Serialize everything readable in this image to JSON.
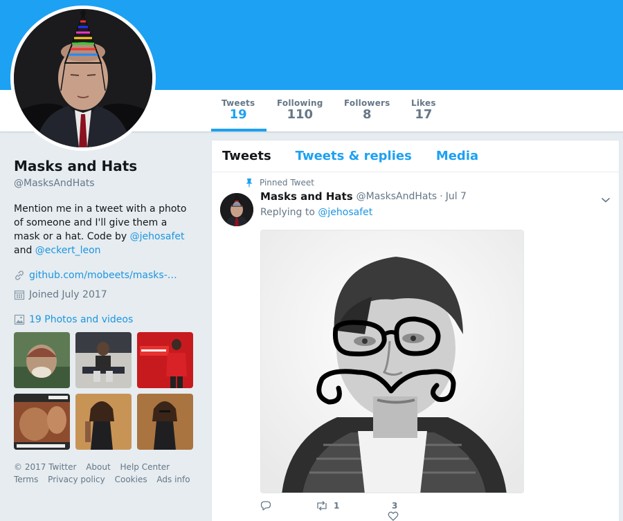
{
  "profile": {
    "name": "Masks and Hats",
    "handle": "@MasksAndHats",
    "bio_text": "Mention me in a tweet with a photo of someone and I'll give them a mask or a hat. Code by ",
    "bio_link1": "@jehosafet",
    "bio_and": " and ",
    "bio_link2": "@eckert_leon",
    "url": "github.com/mobeets/masks-…",
    "joined": "Joined July 2017",
    "photos_label": "19 Photos and videos"
  },
  "stats": [
    {
      "label": "Tweets",
      "value": "19"
    },
    {
      "label": "Following",
      "value": "110"
    },
    {
      "label": "Followers",
      "value": "8"
    },
    {
      "label": "Likes",
      "value": "17"
    }
  ],
  "tabs": [
    "Tweets",
    "Tweets & replies",
    "Media"
  ],
  "tweet": {
    "pinned_label": "Pinned Tweet",
    "author": "Masks and Hats",
    "handle": "@MasksAndHats",
    "separator": "·",
    "date": "Jul 7",
    "replying_prefix": "Replying to ",
    "replying_to": "@jehosafet",
    "retweets": "1",
    "likes": "3"
  },
  "footer": {
    "copyright": "© 2017 Twitter",
    "about": "About",
    "help": "Help Center",
    "terms": "Terms",
    "privacy": "Privacy policy",
    "cookies": "Cookies",
    "ads": "Ads info"
  },
  "colors": {
    "brand": "#1da1f2",
    "link": "#1b95e0",
    "muted": "#657786",
    "background": "#e6ecf0"
  },
  "icons": {
    "url": "link-icon",
    "joined": "calendar-icon",
    "photos": "image-icon",
    "pinned": "pin-icon",
    "caret": "chevron-down-icon",
    "reply": "reply-icon",
    "retweet": "retweet-icon",
    "like": "heart-icon"
  }
}
